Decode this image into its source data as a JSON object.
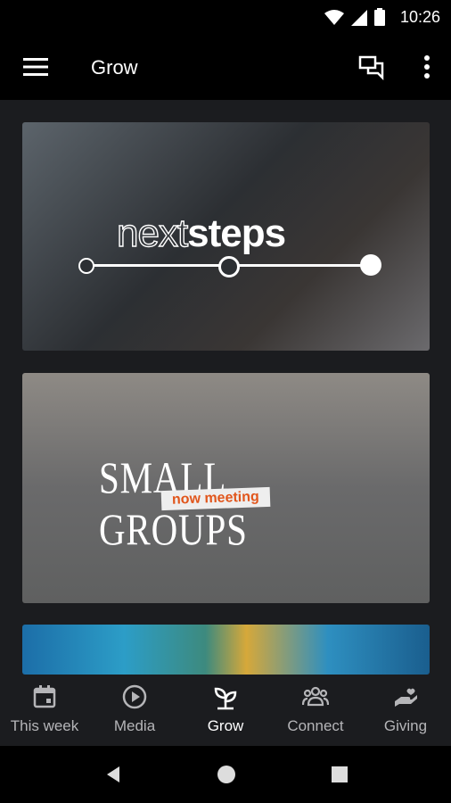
{
  "status_bar": {
    "time": "10:26"
  },
  "app_bar": {
    "title": "Grow",
    "icons": {
      "menu": "hamburger-icon",
      "chat": "chat-icon",
      "more": "more-vertical-icon"
    }
  },
  "cards": [
    {
      "name": "next-steps",
      "line1": "next",
      "line2": "steps"
    },
    {
      "name": "small-groups",
      "title": "SMALL GROUPS",
      "tag": "now meeting"
    },
    {
      "name": "third-card"
    }
  ],
  "bottom_nav": {
    "items": [
      {
        "label": "This week",
        "icon": "calendar-icon",
        "active": false
      },
      {
        "label": "Media",
        "icon": "play-circle-icon",
        "active": false
      },
      {
        "label": "Grow",
        "icon": "sprout-icon",
        "active": true
      },
      {
        "label": "Connect",
        "icon": "people-icon",
        "active": false
      },
      {
        "label": "Giving",
        "icon": "hand-heart-icon",
        "active": false
      }
    ]
  },
  "colors": {
    "accent_tag": "#e1561c",
    "background": "#1b1c1f",
    "bar": "#000000",
    "inactive_label": "#b5b5b8"
  }
}
